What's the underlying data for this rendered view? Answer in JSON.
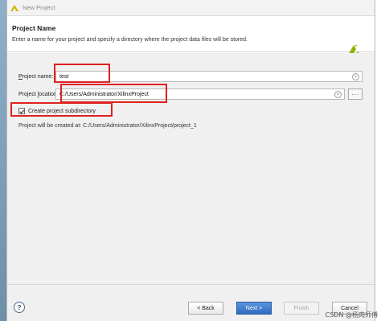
{
  "window": {
    "title": "New Project"
  },
  "header": {
    "title": "Project Name",
    "description": "Enter a name for your project and specify a directory where the project data files will be stored."
  },
  "form": {
    "project_name": {
      "label_prefix": "",
      "label_underlined": "P",
      "label_rest": "roject name:",
      "value": "test"
    },
    "project_location": {
      "label_prefix": "Project ",
      "label_underlined": "l",
      "label_rest": "ocation:",
      "value": "C:/Users/Administrator/XilinxProject",
      "browse_label": "···"
    },
    "create_subdirectory": {
      "label": "Create project subdirectory",
      "checked": true
    },
    "path_note": "Project will be created at: C:/Users/Administrator/XilinxProject/project_1"
  },
  "footer": {
    "help_label": "?",
    "back_label": "< Back",
    "next_label": "Next >",
    "finish_label": "Finish",
    "cancel_label": "Cancel"
  },
  "watermark": "CSDN @杨肉师傅",
  "colors": {
    "highlight": "#e02020",
    "primary_button": "#2f6cc0",
    "logo": "#8cb400"
  }
}
